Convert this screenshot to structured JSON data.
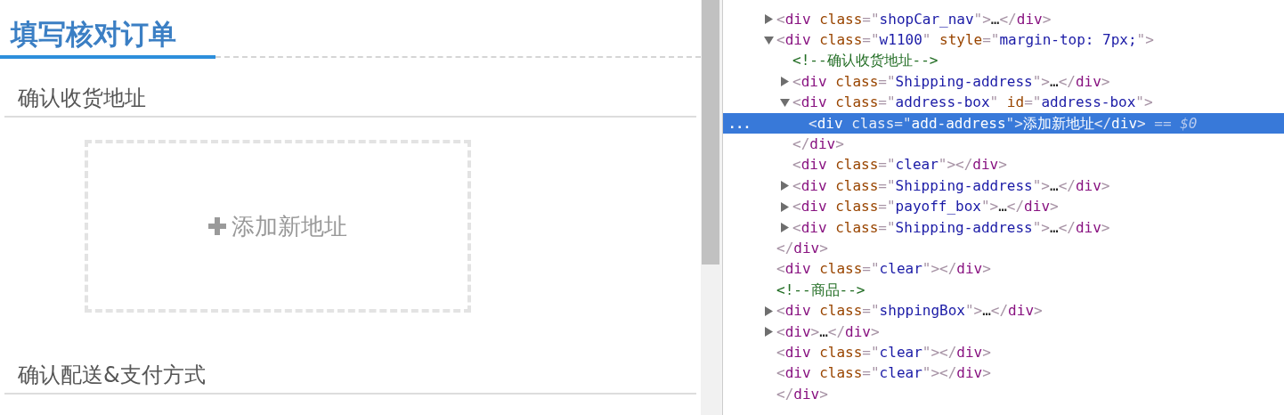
{
  "page": {
    "title": "填写核对订单",
    "sections": [
      {
        "heading": "确认收货地址"
      },
      {
        "heading": "确认配送&支付方式"
      }
    ],
    "add_address": {
      "label": "添加新地址"
    }
  },
  "devtools": {
    "nodes": [
      {
        "expanded": false,
        "selected": false,
        "tokens": [
          {
            "kind": "punct",
            "text": "<"
          },
          {
            "kind": "tag",
            "text": "div"
          },
          {
            "kind": "attr",
            "text": " class"
          },
          {
            "kind": "punct",
            "text": "=\""
          },
          {
            "kind": "value",
            "text": "shopCar_nav"
          },
          {
            "kind": "punct",
            "text": "\">"
          },
          {
            "kind": "text",
            "text": "…"
          },
          {
            "kind": "punct",
            "text": "</"
          },
          {
            "kind": "tag",
            "text": "div"
          },
          {
            "kind": "punct",
            "text": ">"
          }
        ]
      },
      {
        "expanded": true,
        "selected": false,
        "tokens": [
          {
            "kind": "punct",
            "text": "<"
          },
          {
            "kind": "tag",
            "text": "div"
          },
          {
            "kind": "attr",
            "text": " class"
          },
          {
            "kind": "punct",
            "text": "=\""
          },
          {
            "kind": "value",
            "text": "w1100"
          },
          {
            "kind": "punct",
            "text": "\""
          },
          {
            "kind": "attr",
            "text": " style"
          },
          {
            "kind": "punct",
            "text": "=\""
          },
          {
            "kind": "value",
            "text": "margin-top: 7px;"
          },
          {
            "kind": "punct",
            "text": "\">"
          }
        ],
        "children": [
          {
            "selected": false,
            "tokens": [
              {
                "kind": "comment",
                "text": "<!--确认收货地址-->"
              }
            ]
          },
          {
            "expanded": false,
            "selected": false,
            "tokens": [
              {
                "kind": "punct",
                "text": "<"
              },
              {
                "kind": "tag",
                "text": "div"
              },
              {
                "kind": "attr",
                "text": " class"
              },
              {
                "kind": "punct",
                "text": "=\""
              },
              {
                "kind": "value",
                "text": "Shipping-address"
              },
              {
                "kind": "punct",
                "text": "\">"
              },
              {
                "kind": "text",
                "text": "…"
              },
              {
                "kind": "punct",
                "text": "</"
              },
              {
                "kind": "tag",
                "text": "div"
              },
              {
                "kind": "punct",
                "text": ">"
              }
            ]
          },
          {
            "expanded": true,
            "selected": false,
            "tokens": [
              {
                "kind": "punct",
                "text": "<"
              },
              {
                "kind": "tag",
                "text": "div"
              },
              {
                "kind": "attr",
                "text": " class"
              },
              {
                "kind": "punct",
                "text": "=\""
              },
              {
                "kind": "value",
                "text": "address-box"
              },
              {
                "kind": "punct",
                "text": "\""
              },
              {
                "kind": "attr",
                "text": " id"
              },
              {
                "kind": "punct",
                "text": "=\""
              },
              {
                "kind": "value",
                "text": "address-box"
              },
              {
                "kind": "punct",
                "text": "\">"
              }
            ],
            "children": [
              {
                "selected": true,
                "gutter": "...",
                "tokens": [
                  {
                    "kind": "punct",
                    "text": "<"
                  },
                  {
                    "kind": "tag",
                    "text": "div"
                  },
                  {
                    "kind": "attr",
                    "text": " class"
                  },
                  {
                    "kind": "punct",
                    "text": "=\""
                  },
                  {
                    "kind": "value",
                    "text": "add-address"
                  },
                  {
                    "kind": "punct",
                    "text": "\">"
                  },
                  {
                    "kind": "text",
                    "text": "添加新地址"
                  },
                  {
                    "kind": "punct",
                    "text": "</"
                  },
                  {
                    "kind": "tag",
                    "text": "div"
                  },
                  {
                    "kind": "punct",
                    "text": ">"
                  },
                  {
                    "kind": "marker",
                    "text": " == $0"
                  }
                ]
              }
            ],
            "close": [
              {
                "kind": "punct",
                "text": "</"
              },
              {
                "kind": "tag",
                "text": "div"
              },
              {
                "kind": "punct",
                "text": ">"
              }
            ]
          },
          {
            "selected": false,
            "tokens": [
              {
                "kind": "punct",
                "text": "<"
              },
              {
                "kind": "tag",
                "text": "div"
              },
              {
                "kind": "attr",
                "text": " class"
              },
              {
                "kind": "punct",
                "text": "=\""
              },
              {
                "kind": "value",
                "text": "clear"
              },
              {
                "kind": "punct",
                "text": "\">"
              },
              {
                "kind": "punct",
                "text": "</"
              },
              {
                "kind": "tag",
                "text": "div"
              },
              {
                "kind": "punct",
                "text": ">"
              }
            ]
          },
          {
            "expanded": false,
            "selected": false,
            "tokens": [
              {
                "kind": "punct",
                "text": "<"
              },
              {
                "kind": "tag",
                "text": "div"
              },
              {
                "kind": "attr",
                "text": " class"
              },
              {
                "kind": "punct",
                "text": "=\""
              },
              {
                "kind": "value",
                "text": "Shipping-address"
              },
              {
                "kind": "punct",
                "text": "\">"
              },
              {
                "kind": "text",
                "text": "…"
              },
              {
                "kind": "punct",
                "text": "</"
              },
              {
                "kind": "tag",
                "text": "div"
              },
              {
                "kind": "punct",
                "text": ">"
              }
            ]
          },
          {
            "expanded": false,
            "selected": false,
            "tokens": [
              {
                "kind": "punct",
                "text": "<"
              },
              {
                "kind": "tag",
                "text": "div"
              },
              {
                "kind": "attr",
                "text": " class"
              },
              {
                "kind": "punct",
                "text": "=\""
              },
              {
                "kind": "value",
                "text": "payoff_box"
              },
              {
                "kind": "punct",
                "text": "\">"
              },
              {
                "kind": "text",
                "text": "…"
              },
              {
                "kind": "punct",
                "text": "</"
              },
              {
                "kind": "tag",
                "text": "div"
              },
              {
                "kind": "punct",
                "text": ">"
              }
            ]
          },
          {
            "expanded": false,
            "selected": false,
            "tokens": [
              {
                "kind": "punct",
                "text": "<"
              },
              {
                "kind": "tag",
                "text": "div"
              },
              {
                "kind": "attr",
                "text": " class"
              },
              {
                "kind": "punct",
                "text": "=\""
              },
              {
                "kind": "value",
                "text": "Shipping-address"
              },
              {
                "kind": "punct",
                "text": "\">"
              },
              {
                "kind": "text",
                "text": "…"
              },
              {
                "kind": "punct",
                "text": "</"
              },
              {
                "kind": "tag",
                "text": "div"
              },
              {
                "kind": "punct",
                "text": ">"
              }
            ]
          }
        ],
        "close": [
          {
            "kind": "punct",
            "text": "</"
          },
          {
            "kind": "tag",
            "text": "div"
          },
          {
            "kind": "punct",
            "text": ">"
          }
        ]
      },
      {
        "selected": false,
        "tokens": [
          {
            "kind": "punct",
            "text": "<"
          },
          {
            "kind": "tag",
            "text": "div"
          },
          {
            "kind": "attr",
            "text": " class"
          },
          {
            "kind": "punct",
            "text": "=\""
          },
          {
            "kind": "value",
            "text": "clear"
          },
          {
            "kind": "punct",
            "text": "\">"
          },
          {
            "kind": "punct",
            "text": "</"
          },
          {
            "kind": "tag",
            "text": "div"
          },
          {
            "kind": "punct",
            "text": ">"
          }
        ]
      },
      {
        "selected": false,
        "tokens": [
          {
            "kind": "comment",
            "text": "<!--商品-->"
          }
        ]
      },
      {
        "expanded": false,
        "selected": false,
        "tokens": [
          {
            "kind": "punct",
            "text": "<"
          },
          {
            "kind": "tag",
            "text": "div"
          },
          {
            "kind": "attr",
            "text": " class"
          },
          {
            "kind": "punct",
            "text": "=\""
          },
          {
            "kind": "value",
            "text": "shppingBox"
          },
          {
            "kind": "punct",
            "text": "\">"
          },
          {
            "kind": "text",
            "text": "…"
          },
          {
            "kind": "punct",
            "text": "</"
          },
          {
            "kind": "tag",
            "text": "div"
          },
          {
            "kind": "punct",
            "text": ">"
          }
        ]
      },
      {
        "expanded": false,
        "selected": false,
        "tokens": [
          {
            "kind": "punct",
            "text": "<"
          },
          {
            "kind": "tag",
            "text": "div"
          },
          {
            "kind": "punct",
            "text": ">"
          },
          {
            "kind": "text",
            "text": "…"
          },
          {
            "kind": "punct",
            "text": "</"
          },
          {
            "kind": "tag",
            "text": "div"
          },
          {
            "kind": "punct",
            "text": ">"
          }
        ]
      },
      {
        "selected": false,
        "tokens": [
          {
            "kind": "punct",
            "text": "<"
          },
          {
            "kind": "tag",
            "text": "div"
          },
          {
            "kind": "attr",
            "text": " class"
          },
          {
            "kind": "punct",
            "text": "=\""
          },
          {
            "kind": "value",
            "text": "clear"
          },
          {
            "kind": "punct",
            "text": "\">"
          },
          {
            "kind": "punct",
            "text": "</"
          },
          {
            "kind": "tag",
            "text": "div"
          },
          {
            "kind": "punct",
            "text": ">"
          }
        ]
      },
      {
        "selected": false,
        "tokens": [
          {
            "kind": "punct",
            "text": "<"
          },
          {
            "kind": "tag",
            "text": "div"
          },
          {
            "kind": "attr",
            "text": " class"
          },
          {
            "kind": "punct",
            "text": "=\""
          },
          {
            "kind": "value",
            "text": "clear"
          },
          {
            "kind": "punct",
            "text": "\">"
          },
          {
            "kind": "punct",
            "text": "</"
          },
          {
            "kind": "tag",
            "text": "div"
          },
          {
            "kind": "punct",
            "text": ">"
          }
        ]
      }
    ],
    "closing_line": [
      {
        "kind": "punct",
        "text": "</"
      },
      {
        "kind": "tag",
        "text": "div"
      },
      {
        "kind": "punct",
        "text": ">"
      }
    ]
  }
}
